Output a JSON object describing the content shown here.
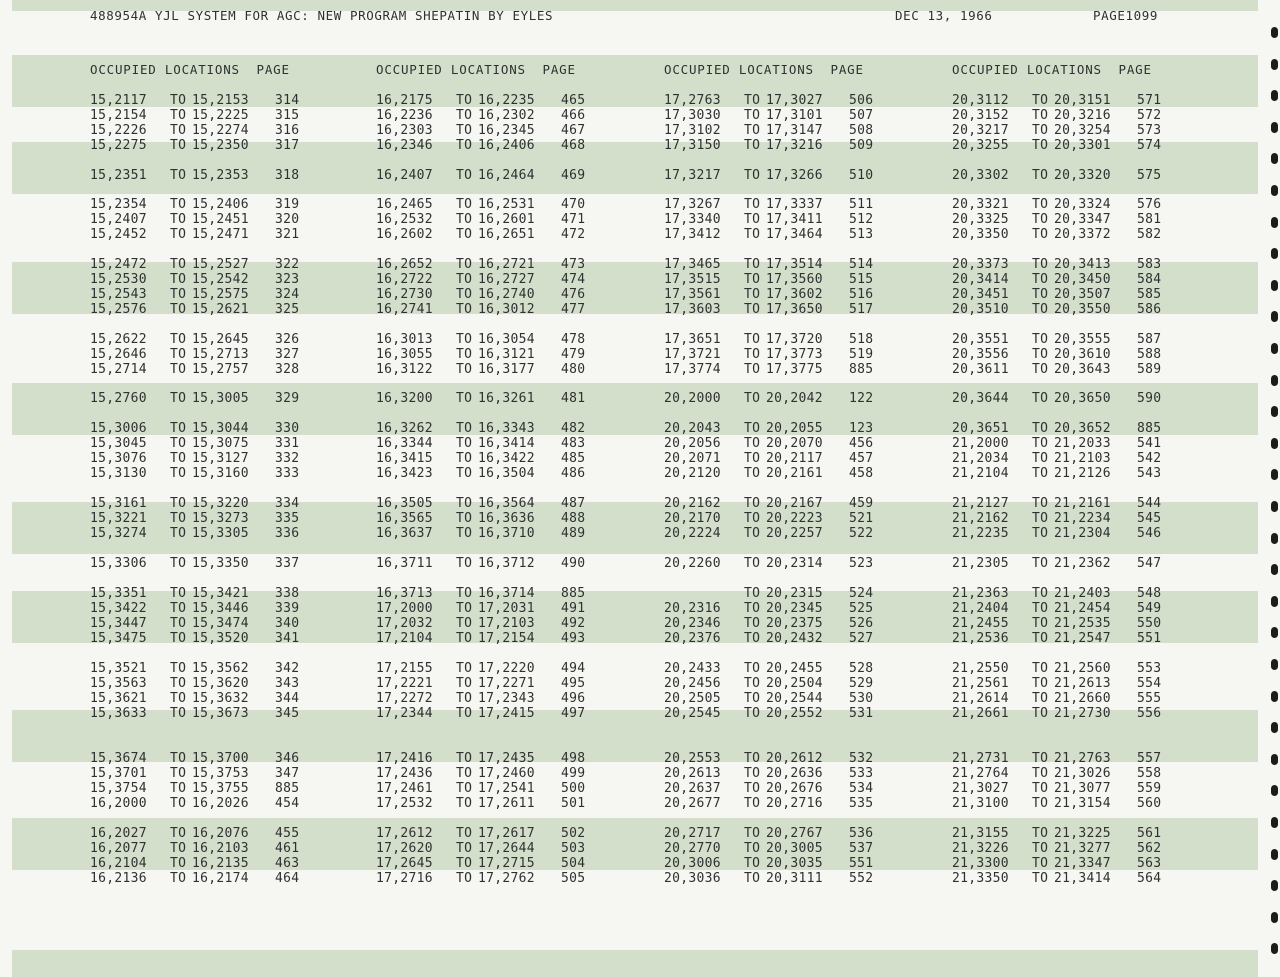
{
  "header": {
    "title": "488954A YJL SYSTEM FOR AGC: NEW PROGRAM SHEPATIN BY EYLES",
    "date": "DEC 13, 1966",
    "page": "PAGE1099"
  },
  "column_header": "OCCUPIED LOCATIONS  PAGE",
  "table": {
    "to_label": "TO",
    "columns": [
      {
        "groups": [
          [
            [
              "15,2117",
              "15,2153",
              "314"
            ],
            [
              "15,2154",
              "15,2225",
              "315"
            ],
            [
              "15,2226",
              "15,2274",
              "316"
            ],
            [
              "15,2275",
              "15,2350",
              "317"
            ]
          ],
          [
            [
              "15,2351",
              "15,2353",
              "318"
            ]
          ],
          [
            [
              "15,2354",
              "15,2406",
              "319"
            ],
            [
              "15,2407",
              "15,2451",
              "320"
            ],
            [
              "15,2452",
              "15,2471",
              "321"
            ]
          ],
          [
            [
              "15,2472",
              "15,2527",
              "322"
            ],
            [
              "15,2530",
              "15,2542",
              "323"
            ],
            [
              "15,2543",
              "15,2575",
              "324"
            ],
            [
              "15,2576",
              "15,2621",
              "325"
            ]
          ],
          [
            [
              "15,2622",
              "15,2645",
              "326"
            ],
            [
              "15,2646",
              "15,2713",
              "327"
            ],
            [
              "15,2714",
              "15,2757",
              "328"
            ]
          ],
          [
            [
              "15,2760",
              "15,3005",
              "329"
            ]
          ],
          [
            [
              "15,3006",
              "15,3044",
              "330"
            ],
            [
              "15,3045",
              "15,3075",
              "331"
            ],
            [
              "15,3076",
              "15,3127",
              "332"
            ],
            [
              "15,3130",
              "15,3160",
              "333"
            ]
          ],
          [
            [
              "15,3161",
              "15,3220",
              "334"
            ],
            [
              "15,3221",
              "15,3273",
              "335"
            ],
            [
              "15,3274",
              "15,3305",
              "336"
            ]
          ],
          [
            [
              "15,3306",
              "15,3350",
              "337"
            ]
          ],
          [
            [
              "15,3351",
              "15,3421",
              "338"
            ],
            [
              "15,3422",
              "15,3446",
              "339"
            ],
            [
              "15,3447",
              "15,3474",
              "340"
            ],
            [
              "15,3475",
              "15,3520",
              "341"
            ]
          ],
          [
            [
              "15,3521",
              "15,3562",
              "342"
            ],
            [
              "15,3563",
              "15,3620",
              "343"
            ],
            [
              "15,3621",
              "15,3632",
              "344"
            ],
            [
              "15,3633",
              "15,3673",
              "345"
            ]
          ],
          [
            [
              "15,3674",
              "15,3700",
              "346"
            ],
            [
              "15,3701",
              "15,3753",
              "347"
            ],
            [
              "15,3754",
              "15,3755",
              "885"
            ],
            [
              "16,2000",
              "16,2026",
              "454"
            ]
          ],
          [
            [
              "16,2027",
              "16,2076",
              "455"
            ],
            [
              "16,2077",
              "16,2103",
              "461"
            ],
            [
              "16,2104",
              "16,2135",
              "463"
            ],
            [
              "16,2136",
              "16,2174",
              "464"
            ]
          ]
        ]
      },
      {
        "groups": [
          [
            [
              "16,2175",
              "16,2235",
              "465"
            ],
            [
              "16,2236",
              "16,2302",
              "466"
            ],
            [
              "16,2303",
              "16,2345",
              "467"
            ],
            [
              "16,2346",
              "16,2406",
              "468"
            ]
          ],
          [
            [
              "16,2407",
              "16,2464",
              "469"
            ]
          ],
          [
            [
              "16,2465",
              "16,2531",
              "470"
            ],
            [
              "16,2532",
              "16,2601",
              "471"
            ],
            [
              "16,2602",
              "16,2651",
              "472"
            ]
          ],
          [
            [
              "16,2652",
              "16,2721",
              "473"
            ],
            [
              "16,2722",
              "16,2727",
              "474"
            ],
            [
              "16,2730",
              "16,2740",
              "476"
            ],
            [
              "16,2741",
              "16,3012",
              "477"
            ]
          ],
          [
            [
              "16,3013",
              "16,3054",
              "478"
            ],
            [
              "16,3055",
              "16,3121",
              "479"
            ],
            [
              "16,3122",
              "16,3177",
              "480"
            ]
          ],
          [
            [
              "16,3200",
              "16,3261",
              "481"
            ]
          ],
          [
            [
              "16,3262",
              "16,3343",
              "482"
            ],
            [
              "16,3344",
              "16,3414",
              "483"
            ],
            [
              "16,3415",
              "16,3422",
              "485"
            ],
            [
              "16,3423",
              "16,3504",
              "486"
            ]
          ],
          [
            [
              "16,3505",
              "16,3564",
              "487"
            ],
            [
              "16,3565",
              "16,3636",
              "488"
            ],
            [
              "16,3637",
              "16,3710",
              "489"
            ]
          ],
          [
            [
              "16,3711",
              "16,3712",
              "490"
            ]
          ],
          [
            [
              "16,3713",
              "16,3714",
              "885"
            ],
            [
              "17,2000",
              "17,2031",
              "491"
            ],
            [
              "17,2032",
              "17,2103",
              "492"
            ],
            [
              "17,2104",
              "17,2154",
              "493"
            ]
          ],
          [
            [
              "17,2155",
              "17,2220",
              "494"
            ],
            [
              "17,2221",
              "17,2271",
              "495"
            ],
            [
              "17,2272",
              "17,2343",
              "496"
            ],
            [
              "17,2344",
              "17,2415",
              "497"
            ]
          ],
          [
            [
              "17,2416",
              "17,2435",
              "498"
            ],
            [
              "17,2436",
              "17,2460",
              "499"
            ],
            [
              "17,2461",
              "17,2541",
              "500"
            ],
            [
              "17,2532",
              "17,2611",
              "501"
            ]
          ],
          [
            [
              "17,2612",
              "17,2617",
              "502"
            ],
            [
              "17,2620",
              "17,2644",
              "503"
            ],
            [
              "17,2645",
              "17,2715",
              "504"
            ],
            [
              "17,2716",
              "17,2762",
              "505"
            ]
          ]
        ]
      },
      {
        "groups": [
          [
            [
              "17,2763",
              "17,3027",
              "506"
            ],
            [
              "17,3030",
              "17,3101",
              "507"
            ],
            [
              "17,3102",
              "17,3147",
              "508"
            ],
            [
              "17,3150",
              "17,3216",
              "509"
            ]
          ],
          [
            [
              "17,3217",
              "17,3266",
              "510"
            ]
          ],
          [
            [
              "17,3267",
              "17,3337",
              "511"
            ],
            [
              "17,3340",
              "17,3411",
              "512"
            ],
            [
              "17,3412",
              "17,3464",
              "513"
            ]
          ],
          [
            [
              "17,3465",
              "17,3514",
              "514"
            ],
            [
              "17,3515",
              "17,3560",
              "515"
            ],
            [
              "17,3561",
              "17,3602",
              "516"
            ],
            [
              "17,3603",
              "17,3650",
              "517"
            ]
          ],
          [
            [
              "17,3651",
              "17,3720",
              "518"
            ],
            [
              "17,3721",
              "17,3773",
              "519"
            ],
            [
              "17,3774",
              "17,3775",
              "885"
            ]
          ],
          [
            [
              "20,2000",
              "20,2042",
              "122"
            ]
          ],
          [
            [
              "20,2043",
              "20,2055",
              "123"
            ],
            [
              "20,2056",
              "20,2070",
              "456"
            ],
            [
              "20,2071",
              "20,2117",
              "457"
            ],
            [
              "20,2120",
              "20,2161",
              "458"
            ]
          ],
          [
            [
              "20,2162",
              "20,2167",
              "459"
            ],
            [
              "20,2170",
              "20,2223",
              "521"
            ],
            [
              "20,2224",
              "20,2257",
              "522"
            ]
          ],
          [
            [
              "20,2260",
              "20,2314",
              "523"
            ]
          ],
          [
            [
              "",
              "20,2315",
              "524"
            ],
            [
              "20,2316",
              "20,2345",
              "525"
            ],
            [
              "20,2346",
              "20,2375",
              "526"
            ],
            [
              "20,2376",
              "20,2432",
              "527"
            ]
          ],
          [
            [
              "20,2433",
              "20,2455",
              "528"
            ],
            [
              "20,2456",
              "20,2504",
              "529"
            ],
            [
              "20,2505",
              "20,2544",
              "530"
            ],
            [
              "20,2545",
              "20,2552",
              "531"
            ]
          ],
          [
            [
              "20,2553",
              "20,2612",
              "532"
            ],
            [
              "20,2613",
              "20,2636",
              "533"
            ],
            [
              "20,2637",
              "20,2676",
              "534"
            ],
            [
              "20,2677",
              "20,2716",
              "535"
            ]
          ],
          [
            [
              "20,2717",
              "20,2767",
              "536"
            ],
            [
              "20,2770",
              "20,3005",
              "537"
            ],
            [
              "20,3006",
              "20,3035",
              "551"
            ],
            [
              "20,3036",
              "20,3111",
              "552"
            ]
          ]
        ]
      },
      {
        "groups": [
          [
            [
              "20,3112",
              "20,3151",
              "571"
            ],
            [
              "20,3152",
              "20,3216",
              "572"
            ],
            [
              "20,3217",
              "20,3254",
              "573"
            ],
            [
              "20,3255",
              "20,3301",
              "574"
            ]
          ],
          [
            [
              "20,3302",
              "20,3320",
              "575"
            ]
          ],
          [
            [
              "20,3321",
              "20,3324",
              "576"
            ],
            [
              "20,3325",
              "20,3347",
              "581"
            ],
            [
              "20,3350",
              "20,3372",
              "582"
            ]
          ],
          [
            [
              "20,3373",
              "20,3413",
              "583"
            ],
            [
              "20,3414",
              "20,3450",
              "584"
            ],
            [
              "20,3451",
              "20,3507",
              "585"
            ],
            [
              "20,3510",
              "20,3550",
              "586"
            ]
          ],
          [
            [
              "20,3551",
              "20,3555",
              "587"
            ],
            [
              "20,3556",
              "20,3610",
              "588"
            ],
            [
              "20,3611",
              "20,3643",
              "589"
            ]
          ],
          [
            [
              "20,3644",
              "20,3650",
              "590"
            ]
          ],
          [
            [
              "20,3651",
              "20,3652",
              "885"
            ],
            [
              "21,2000",
              "21,2033",
              "541"
            ],
            [
              "21,2034",
              "21,2103",
              "542"
            ],
            [
              "21,2104",
              "21,2126",
              "543"
            ]
          ],
          [
            [
              "21,2127",
              "21,2161",
              "544"
            ],
            [
              "21,2162",
              "21,2234",
              "545"
            ],
            [
              "21,2235",
              "21,2304",
              "546"
            ]
          ],
          [
            [
              "21,2305",
              "21,2362",
              "547"
            ]
          ],
          [
            [
              "21,2363",
              "21,2403",
              "548"
            ],
            [
              "21,2404",
              "21,2454",
              "549"
            ],
            [
              "21,2455",
              "21,2535",
              "550"
            ],
            [
              "21,2536",
              "21,2547",
              "551"
            ]
          ],
          [
            [
              "21,2550",
              "21,2560",
              "553"
            ],
            [
              "21,2561",
              "21,2613",
              "554"
            ],
            [
              "21,2614",
              "21,2660",
              "555"
            ],
            [
              "21,2661",
              "21,2730",
              "556"
            ]
          ],
          [
            [
              "21,2731",
              "21,2763",
              "557"
            ],
            [
              "21,2764",
              "21,3026",
              "558"
            ],
            [
              "21,3027",
              "21,3077",
              "559"
            ],
            [
              "21,3100",
              "21,3154",
              "560"
            ]
          ],
          [
            [
              "21,3155",
              "21,3225",
              "561"
            ],
            [
              "21,3226",
              "21,3277",
              "562"
            ],
            [
              "21,3300",
              "21,3347",
              "563"
            ],
            [
              "21,3350",
              "21,3414",
              "564"
            ]
          ]
        ]
      }
    ]
  }
}
